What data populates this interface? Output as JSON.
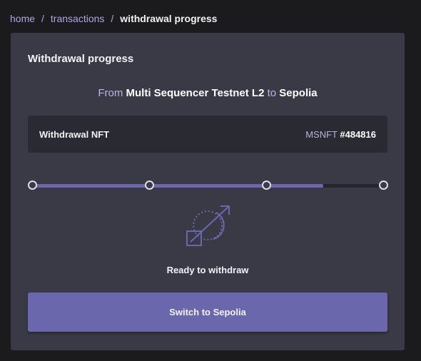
{
  "breadcrumb": {
    "items": [
      "home",
      "transactions"
    ],
    "current": "withdrawal progress",
    "separator": "/"
  },
  "card": {
    "title": "Withdrawal progress",
    "route": {
      "from_word": "From",
      "from_chain": "Multi Sequencer Testnet L2",
      "to_word": "to",
      "to_chain": "Sepolia"
    },
    "nft": {
      "label": "Withdrawal NFT",
      "symbol": "MSNFT",
      "id": "#484816"
    },
    "progress": {
      "steps": 4,
      "fill_fraction": 0.83
    },
    "status_icon": "withdraw-swap-icon",
    "status_text": "Ready to withdraw",
    "action_button": "Switch to Sepolia"
  },
  "colors": {
    "accent": "#6b67ad",
    "link": "#a9a6e6",
    "card_bg": "#3a3a46",
    "page_bg": "#1b1b1d"
  }
}
